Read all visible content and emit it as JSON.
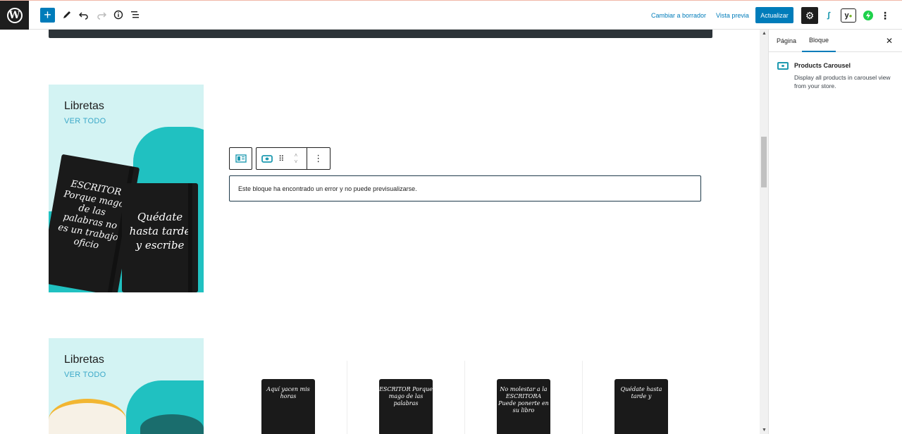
{
  "toolbar": {
    "switch_to_draft": "Cambiar a borrador",
    "preview": "Vista previa",
    "update": "Actualizar"
  },
  "canvas": {
    "promo1": {
      "title": "Libretas",
      "link": "VER TODO"
    },
    "promo2": {
      "title": "Libretas",
      "link": "VER TODO"
    },
    "error_message": "Este bloque ha encontrado un error y no puede previsualizarse.",
    "notebook_left_text": "ESCRITOR Porque mago de las palabras no es un trabajo oficio",
    "notebook_right_text": "Quédate hasta tarde y escribe",
    "products": [
      {
        "text": "Aquí yacen mis horas"
      },
      {
        "text": "ESCRITOR Porque mago de las palabras"
      },
      {
        "text": "No molestar a la ESCRITORA Puede ponerte en su libro"
      },
      {
        "text": "Quédate hasta tarde y"
      }
    ]
  },
  "sidebar": {
    "tab_page": "Página",
    "tab_block": "Bloque",
    "block_name": "Products Carousel",
    "block_description": "Display all products in carousel view from your store."
  },
  "colors": {
    "accent": "#007cba",
    "teal": "#20c1c1",
    "promo_bg": "#d3f3f3"
  }
}
